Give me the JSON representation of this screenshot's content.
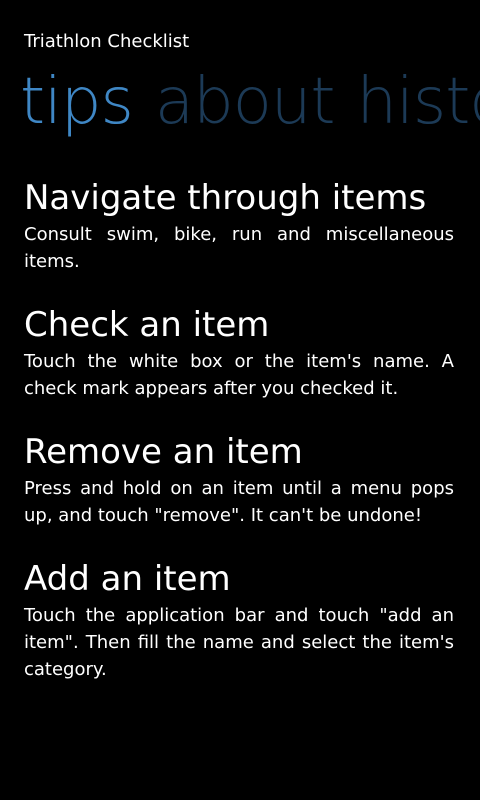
{
  "app": {
    "title": "Triathlon Checklist"
  },
  "pivot": {
    "tabs": [
      {
        "label": "tips",
        "active": true
      },
      {
        "label": "about",
        "active": false
      },
      {
        "label": "history",
        "active": false
      }
    ]
  },
  "tips": [
    {
      "title": "Navigate through items",
      "body": "Consult swim, bike, run and miscellaneous items."
    },
    {
      "title": "Check an item",
      "body": "Touch the white box or the item's name. A check mark appears after you checked it."
    },
    {
      "title": "Remove an item",
      "body": "Press and hold on an item until a menu pops up, and touch \"remove\". It can't be undone!"
    },
    {
      "title": "Add an item",
      "body": "Touch the application bar and touch \"add an item\". Then fill the name and select the item's category."
    }
  ],
  "colors": {
    "accent": "#3f87c5",
    "inactive_tab": "#1c3a56",
    "background": "#000000",
    "text": "#ffffff"
  }
}
